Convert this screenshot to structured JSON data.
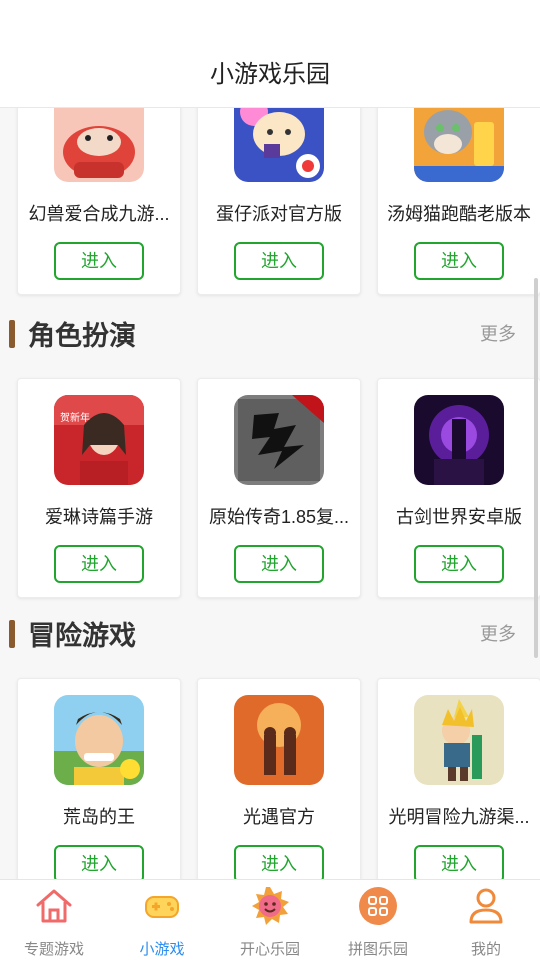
{
  "header": {
    "title": "小游戏乐园"
  },
  "top_row": {
    "cards": [
      {
        "name": "幻兽爱合成九游...",
        "enter": "进入",
        "icon": "red-dragon-game-icon"
      },
      {
        "name": "蛋仔派对官方版",
        "enter": "进入",
        "icon": "egg-party-game-icon"
      },
      {
        "name": "汤姆猫跑酷老版本",
        "enter": "进入",
        "icon": "tom-cat-game-icon"
      }
    ]
  },
  "sections": [
    {
      "title": "角色扮演",
      "more": "更多",
      "cards": [
        {
          "name": "爱琳诗篇手游",
          "enter": "进入",
          "icon": "woman-portrait-game-icon"
        },
        {
          "name": "原始传奇1.85复...",
          "enter": "进入",
          "icon": "dragon-calligraphy-game-icon"
        },
        {
          "name": "古剑世界安卓版",
          "enter": "进入",
          "icon": "purple-throne-game-icon"
        }
      ]
    },
    {
      "title": "冒险游戏",
      "more": "更多",
      "cards": [
        {
          "name": "荒岛的王",
          "enter": "进入",
          "icon": "cartoon-man-game-icon"
        },
        {
          "name": "光遇官方",
          "enter": "进入",
          "icon": "sky-children-game-icon"
        },
        {
          "name": "光明冒险九游渠...",
          "enter": "进入",
          "icon": "pixel-hero-game-icon"
        }
      ]
    }
  ],
  "tabbar": {
    "items": [
      {
        "label": "专题游戏",
        "icon": "home-icon"
      },
      {
        "label": "小游戏",
        "icon": "gamepad-icon",
        "active": true
      },
      {
        "label": "开心乐园",
        "icon": "smiley-sun-icon"
      },
      {
        "label": "拼图乐园",
        "icon": "grid-icon"
      },
      {
        "label": "我的",
        "icon": "user-icon"
      }
    ]
  },
  "colors": {
    "accent_green": "#22a52f",
    "active_tab": "#2b8df0",
    "section_bar": "#8a5b2e",
    "icon_orange": "#f08a4b"
  }
}
